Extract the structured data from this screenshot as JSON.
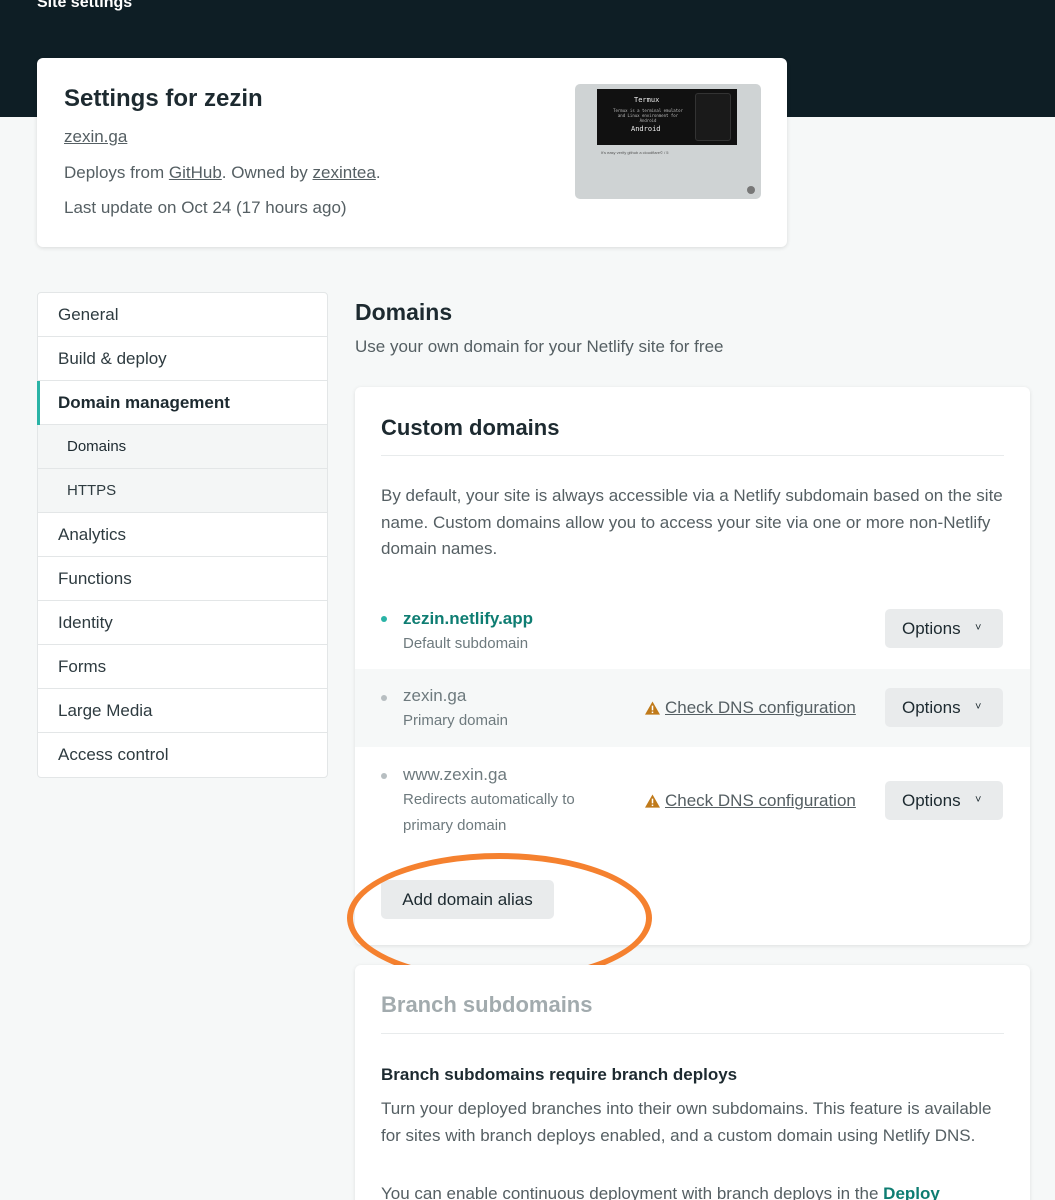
{
  "topbar": {
    "title": "Site settings"
  },
  "site": {
    "heading": "Settings for zezin",
    "url": "zexin.ga",
    "deploys_prefix": "Deploys from ",
    "provider": "GitHub",
    "owned_by": ". Owned by ",
    "owner": "zexintea",
    "period": ".",
    "last_update": "Last update on Oct 24 (17 hours ago)",
    "thumbnail": {
      "title": "Termux",
      "subtitle": "Termux is a terminal emulator and Linux environment for Android",
      "label": "Android",
      "caption": "It's easy verify github a cloudflare© / 5"
    }
  },
  "sidebar": {
    "items": [
      {
        "label": "General"
      },
      {
        "label": "Build & deploy"
      },
      {
        "label": "Domain management"
      },
      {
        "label": "Domains"
      },
      {
        "label": "HTTPS"
      },
      {
        "label": "Analytics"
      },
      {
        "label": "Functions"
      },
      {
        "label": "Identity"
      },
      {
        "label": "Forms"
      },
      {
        "label": "Large Media"
      },
      {
        "label": "Access control"
      }
    ]
  },
  "main": {
    "title": "Domains",
    "description": "Use your own domain for your Netlify site for free"
  },
  "custom_domains": {
    "title": "Custom domains",
    "intro": "By default, your site is always accessible via a Netlify subdomain based on the site name. Custom domains allow you to access your site via one or more non-Netlify domain names.",
    "domains": [
      {
        "name": "zezin.netlify.app",
        "sub": "Default subdomain",
        "options": "Options"
      },
      {
        "name": "zexin.ga",
        "sub": "Primary domain",
        "check": "Check DNS configuration",
        "options": "Options"
      },
      {
        "name": "www.zexin.ga",
        "sub": "Redirects automatically to primary domain",
        "check": "Check DNS configuration",
        "options": "Options"
      }
    ],
    "add_alias": "Add domain alias"
  },
  "branch_subdomains": {
    "title": "Branch subdomains",
    "subtitle": "Branch subdomains require branch deploys",
    "description": "Turn your deployed branches into their own subdomains. This feature is available for sites with branch deploys enabled, and a custom domain using Netlify DNS.",
    "more_prefix": "You can enable continuous deployment with branch deploys in the ",
    "more_link": "Deploy"
  },
  "colors": {
    "accent": "#2ab3a6",
    "link": "#0e7d72",
    "warning": "#c07a1a",
    "annotation": "#f5812f",
    "topbar": "#0e1e25"
  }
}
